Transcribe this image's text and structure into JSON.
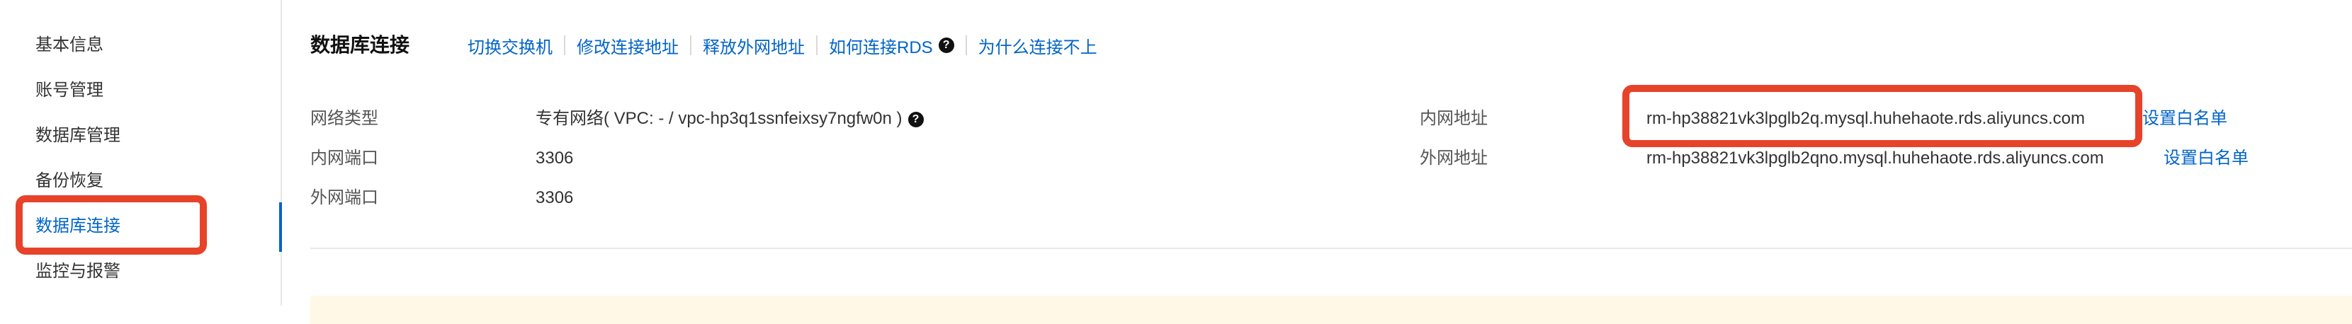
{
  "sidebar": {
    "items": [
      {
        "label": "基本信息"
      },
      {
        "label": "账号管理"
      },
      {
        "label": "数据库管理"
      },
      {
        "label": "备份恢复"
      },
      {
        "label": "数据库连接"
      },
      {
        "label": "监控与报警"
      }
    ],
    "active_index": 4
  },
  "main": {
    "title": "数据库连接",
    "toolbar": {
      "switch_vswitch": "切换交换机",
      "modify_address": "修改连接地址",
      "release_public": "释放外网地址",
      "how_to_connect": "如何连接RDS",
      "why_cannot_connect": "为什么连接不上"
    },
    "info": {
      "network_type_label": "网络类型",
      "network_type_value": "专有网络( VPC: - / vpc-hp3q1ssnfeixsy7ngfw0n )",
      "internal_port_label": "内网端口",
      "internal_port_value": "3306",
      "external_port_label": "外网端口",
      "external_port_value": "3306",
      "internal_address_label": "内网地址",
      "internal_address_value": "rm-hp38821vk3lpglb2q.mysql.huhehaote.rds.aliyuncs.com",
      "external_address_label": "外网地址",
      "external_address_value": "rm-hp38821vk3lpglb2qno.mysql.huhehaote.rds.aliyuncs.com",
      "whitelist_label": "设置白名单"
    }
  },
  "colors": {
    "accent": "#0064c8",
    "highlight": "#e6432a",
    "notice_bg": "#fff8e6"
  },
  "icons": {
    "help": "question-circle-icon"
  }
}
